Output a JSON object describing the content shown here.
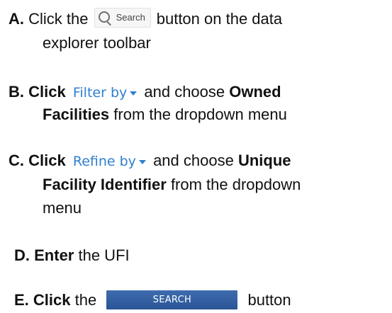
{
  "steps": [
    {
      "letter": "A.",
      "lines": [
        {
          "pre": "Click the",
          "post": "button on the data"
        },
        {
          "text": "explorer toolbar"
        }
      ],
      "button_label": "Search",
      "icon": "magnifying-glass-icon"
    },
    {
      "letter": "B.",
      "lines": [
        {
          "lead": "Click",
          "post_a": "and choose ",
          "post_b": "Owned"
        },
        {
          "strong": "Facilities",
          "rest": " from the dropdown menu"
        }
      ],
      "dropdown_label": "Filter by"
    },
    {
      "letter": "C.",
      "lines": [
        {
          "lead": "Click",
          "post_a": "and choose ",
          "post_b": "Unique"
        },
        {
          "strong": "Facility Identifier",
          "rest": " from the dropdown"
        },
        {
          "text": "menu"
        }
      ],
      "dropdown_label": "Refine by"
    },
    {
      "letter": "D.",
      "lines": [
        {
          "lead": "Enter",
          "rest": " the UFI"
        }
      ]
    },
    {
      "letter": "E.",
      "lines": [
        {
          "lead": "Click",
          "mid": " the",
          "post": "button"
        }
      ],
      "button_label": "SEARCH"
    }
  ],
  "colors": {
    "text": "#111111",
    "link_blue": "#2f7fcf",
    "button_blue": "#2f5b9d"
  }
}
